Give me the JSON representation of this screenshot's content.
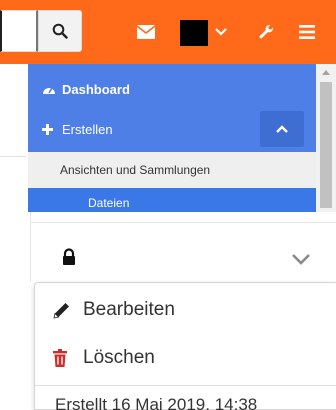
{
  "colors": {
    "topbar": "#ff6a1a",
    "nav": "#4e7fe6",
    "danger": "#c9302c"
  },
  "topbar": {
    "search_placeholder": "",
    "icons": [
      "search-icon",
      "envelope-icon",
      "avatar",
      "chevron-down-icon",
      "wrench-icon",
      "hamburger-icon"
    ]
  },
  "nav": {
    "dashboard": "Dashboard",
    "create": "Erstellen",
    "views": "Ansichten und Sammlungen",
    "files": "Dateien"
  },
  "actions": {
    "edit": "Bearbeiten",
    "delete": "Löschen",
    "created": "Erstellt 16 Mai 2019, 14:38"
  }
}
